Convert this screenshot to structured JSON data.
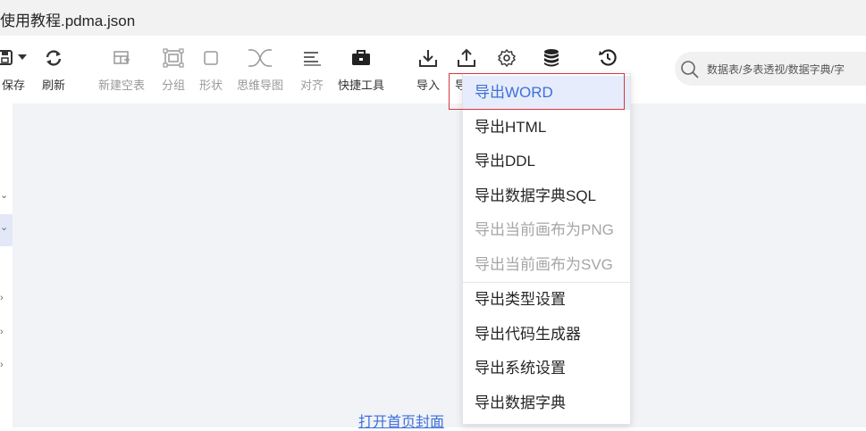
{
  "window": {
    "title": "使用教程.pdma.json"
  },
  "toolbar": {
    "save": "保存",
    "refresh": "刷新",
    "new_table": "新建空表",
    "group": "分组",
    "shape": "形状",
    "mindmap": "思维导图",
    "align": "对齐",
    "quick_tools": "快捷工具",
    "import": "导入",
    "export_partial": "导"
  },
  "search": {
    "placeholder": "数据表/多表透视/数据字典/字"
  },
  "canvas": {
    "cover_link": "打开首页封面"
  },
  "export_menu": {
    "items": [
      {
        "label": "导出WORD",
        "state": "selected"
      },
      {
        "label": "导出HTML",
        "state": "normal"
      },
      {
        "label": "导出DDL",
        "state": "normal"
      },
      {
        "label": "导出数据字典SQL",
        "state": "normal"
      },
      {
        "label": "导出当前画布为PNG",
        "state": "disabled"
      },
      {
        "label": "导出当前画布为SVG",
        "state": "disabled"
      },
      {
        "label": "导出类型设置",
        "state": "normal"
      },
      {
        "label": "导出代码生成器",
        "state": "normal"
      },
      {
        "label": "导出系统设置",
        "state": "normal"
      },
      {
        "label": "导出数据字典",
        "state": "normal"
      }
    ]
  },
  "colors": {
    "accent": "#3f6fd9",
    "highlight_border": "#d9363e",
    "selected_bg": "#e6ecfb"
  }
}
